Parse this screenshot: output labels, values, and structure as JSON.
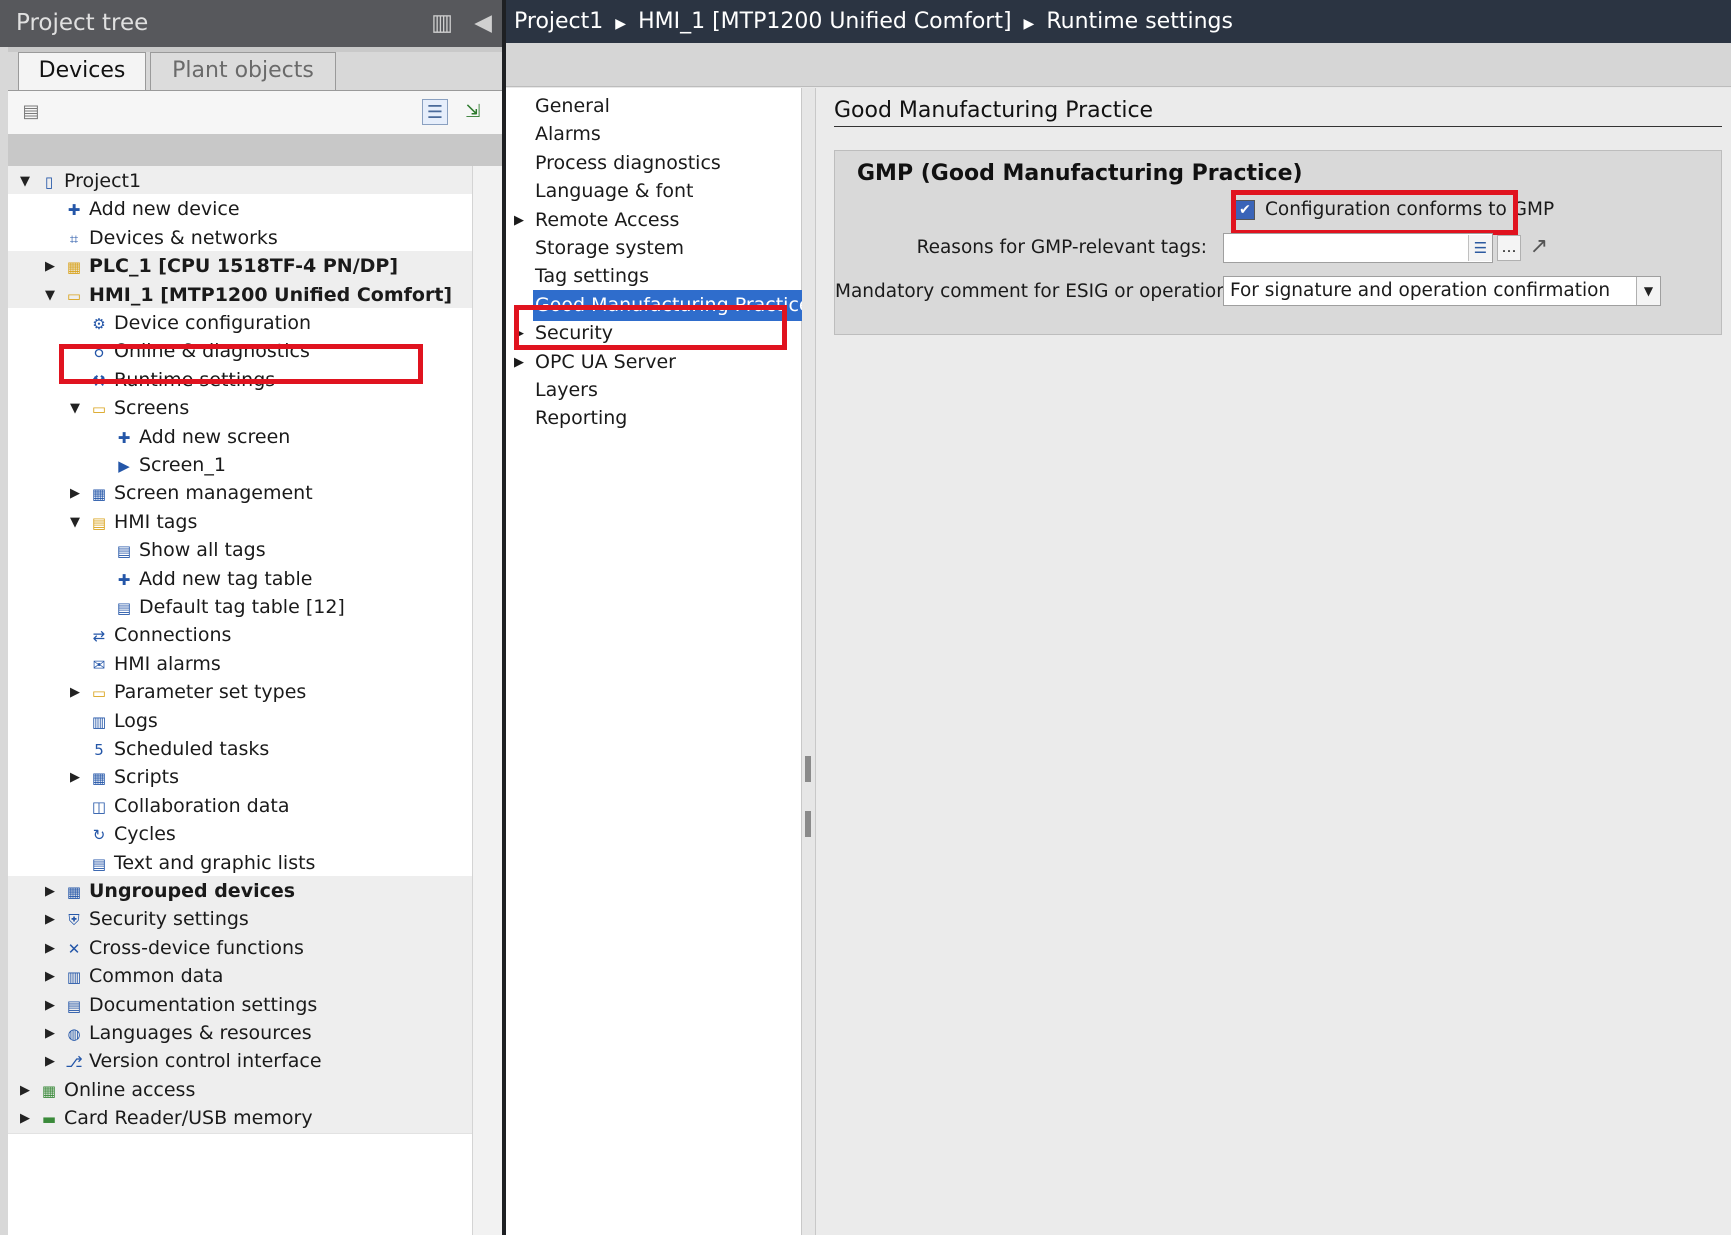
{
  "project_tree": {
    "title": "Project tree",
    "tabs": [
      "Devices",
      "Plant objects"
    ],
    "items": [
      {
        "label": "Project1",
        "level": 0,
        "arrow": "▼",
        "icon": "project-icon",
        "bold": false
      },
      {
        "label": "Add new device",
        "level": 1,
        "arrow": "",
        "icon": "add-device-icon",
        "bold": false
      },
      {
        "label": "Devices & networks",
        "level": 1,
        "arrow": "",
        "icon": "network-icon",
        "bold": false
      },
      {
        "label": "PLC_1 [CPU 1518TF-4 PN/DP]",
        "level": 1,
        "arrow": "▶",
        "icon": "plc-icon",
        "bold": true
      },
      {
        "label": "HMI_1 [MTP1200 Unified Comfort]",
        "level": 1,
        "arrow": "▼",
        "icon": "hmi-icon",
        "bold": true
      },
      {
        "label": "Device configuration",
        "level": 2,
        "arrow": "",
        "icon": "device-config-icon",
        "bold": false
      },
      {
        "label": "Online & diagnostics",
        "level": 2,
        "arrow": "",
        "icon": "diagnostics-icon",
        "bold": false
      },
      {
        "label": "Runtime settings",
        "level": 2,
        "arrow": "",
        "icon": "wrench-icon",
        "bold": false
      },
      {
        "label": "Screens",
        "level": 2,
        "arrow": "▼",
        "icon": "screens-folder-icon",
        "bold": false
      },
      {
        "label": "Add new screen",
        "level": 3,
        "arrow": "",
        "icon": "add-screen-icon",
        "bold": false
      },
      {
        "label": "Screen_1",
        "level": 3,
        "arrow": "",
        "icon": "screen-icon",
        "bold": false
      },
      {
        "label": "Screen management",
        "level": 2,
        "arrow": "▶",
        "icon": "screen-management-icon",
        "bold": false
      },
      {
        "label": "HMI tags",
        "level": 2,
        "arrow": "▼",
        "icon": "tags-folder-icon",
        "bold": false
      },
      {
        "label": "Show all tags",
        "level": 3,
        "arrow": "",
        "icon": "show-tags-icon",
        "bold": false
      },
      {
        "label": "Add new tag table",
        "level": 3,
        "arrow": "",
        "icon": "add-tag-table-icon",
        "bold": false
      },
      {
        "label": "Default tag table [12]",
        "level": 3,
        "arrow": "",
        "icon": "tag-table-icon",
        "bold": false
      },
      {
        "label": "Connections",
        "level": 2,
        "arrow": "",
        "icon": "connections-icon",
        "bold": false
      },
      {
        "label": "HMI alarms",
        "level": 2,
        "arrow": "",
        "icon": "alarm-envelope-icon",
        "bold": false
      },
      {
        "label": "Parameter set types",
        "level": 2,
        "arrow": "▶",
        "icon": "folder-icon",
        "bold": false
      },
      {
        "label": "Logs",
        "level": 2,
        "arrow": "",
        "icon": "logs-icon",
        "bold": false
      },
      {
        "label": "Scheduled tasks",
        "level": 2,
        "arrow": "",
        "icon": "scheduled-tasks-icon",
        "bold": false
      },
      {
        "label": "Scripts",
        "level": 2,
        "arrow": "▶",
        "icon": "scripts-icon",
        "bold": false
      },
      {
        "label": "Collaboration data",
        "level": 2,
        "arrow": "",
        "icon": "collaboration-icon",
        "bold": false
      },
      {
        "label": "Cycles",
        "level": 2,
        "arrow": "",
        "icon": "cycles-icon",
        "bold": false
      },
      {
        "label": "Text and graphic lists",
        "level": 2,
        "arrow": "",
        "icon": "text-graphic-lists-icon",
        "bold": false
      },
      {
        "label": "Ungrouped devices",
        "level": 1,
        "arrow": "▶",
        "icon": "ungrouped-devices-icon",
        "bold": true
      },
      {
        "label": "Security settings",
        "level": 1,
        "arrow": "▶",
        "icon": "security-settings-icon",
        "bold": false
      },
      {
        "label": "Cross-device functions",
        "level": 1,
        "arrow": "▶",
        "icon": "cross-device-icon",
        "bold": false
      },
      {
        "label": "Common data",
        "level": 1,
        "arrow": "▶",
        "icon": "common-data-icon",
        "bold": false
      },
      {
        "label": "Documentation settings",
        "level": 1,
        "arrow": "▶",
        "icon": "documentation-icon",
        "bold": false
      },
      {
        "label": "Languages & resources",
        "level": 1,
        "arrow": "▶",
        "icon": "languages-icon",
        "bold": false
      },
      {
        "label": "Version control interface",
        "level": 1,
        "arrow": "▶",
        "icon": "version-control-icon",
        "bold": false
      },
      {
        "label": "Online access",
        "level": 0,
        "arrow": "▶",
        "icon": "online-access-icon",
        "bold": false
      },
      {
        "label": "Card Reader/USB memory",
        "level": 0,
        "arrow": "▶",
        "icon": "card-reader-icon",
        "bold": false
      }
    ]
  },
  "breadcrumb": [
    "Project1",
    "HMI_1 [MTP1200 Unified Comfort]",
    "Runtime settings"
  ],
  "settings_nav": {
    "items": [
      {
        "label": "General",
        "arrow": ""
      },
      {
        "label": "Alarms",
        "arrow": ""
      },
      {
        "label": "Process diagnostics",
        "arrow": ""
      },
      {
        "label": "Language & font",
        "arrow": ""
      },
      {
        "label": "Remote Access",
        "arrow": "▶"
      },
      {
        "label": "Storage system",
        "arrow": ""
      },
      {
        "label": "Tag settings",
        "arrow": ""
      },
      {
        "label": "Good Manufacturing Practice",
        "arrow": "",
        "selected": true
      },
      {
        "label": "Security",
        "arrow": "▶"
      },
      {
        "label": "OPC UA Server",
        "arrow": "▶"
      },
      {
        "label": "Layers",
        "arrow": ""
      },
      {
        "label": "Reporting",
        "arrow": ""
      }
    ]
  },
  "gmp": {
    "section_title": "Good Manufacturing Practice",
    "box_title": "GMP (Good Manufacturing Practice)",
    "conforms_label": "Configuration conforms to GMP",
    "conforms_checked": true,
    "reasons_label": "Reasons for GMP-relevant tags:",
    "reasons_value": "",
    "comment_label": "Mandatory comment for ESIG or operation:",
    "comment_value": "For signature and operation confirmation"
  },
  "highlight_color": "#e0131f",
  "selection_color": "#2f6dcc"
}
